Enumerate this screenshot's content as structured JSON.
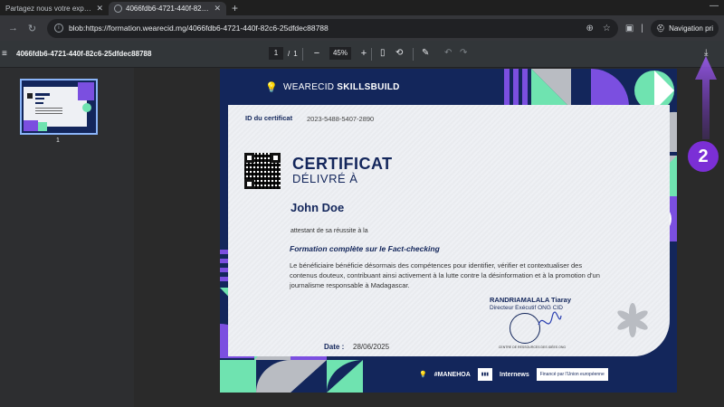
{
  "browser": {
    "tabs": [
      {
        "title": "Partagez nous votre expérience",
        "active": false
      },
      {
        "title": "4066fdb6-4721-440f-82c6-25d",
        "active": true
      }
    ],
    "new_tab_symbol": "+",
    "url": "blob:https://formation.wearecid.mg/4066fdb6-4721-440f-82c6-25dfdec88788",
    "incognito_label": "Navigation pri"
  },
  "pdf_toolbar": {
    "doc_title": "4066fdb6-4721-440f-82c6-25dfdec88788",
    "current_page": "1",
    "page_separator": "/",
    "total_pages": "1",
    "zoom": "45%"
  },
  "sidebar": {
    "thumbnail_label": "1"
  },
  "certificate": {
    "brand_thin": "WEARECID",
    "brand_bold": "SKILLSBUILD",
    "id_label": "ID du certificat",
    "id_value": "2023-5488-5407-2890",
    "title": "CERTIFICAT",
    "subtitle": "DÉLIVRÉ À",
    "recipient": "John Doe",
    "attest_text": "attestant de sa réussite à la",
    "course": "Formation complète sur le Fact-checking",
    "description": "Le bénéficiaire bénéficie désormais des compétences pour identifier, vérifier et contextualiser des contenus douteux, contribuant ainsi activement à la lutte contre la désinformation et à la promotion d'un journalisme responsable à Madagascar.",
    "signer_name": "RANDRIAMALALA Tiaray",
    "signer_role": "Directeur Exécutif ONG CID",
    "seal_caption": "CENTRE DE RESSOURCES DES IDÉES ONG",
    "date_label": "Date :",
    "date_value": "28/06/2025",
    "footer_logos": [
      "#MANEHOA",
      "Internews",
      "Financé par l'Union européenne"
    ]
  },
  "annotation": {
    "step_number": "2"
  },
  "colors": {
    "navy": "#13265b",
    "purple": "#7b4fe0",
    "mint": "#6fe3b0",
    "grey": "#b9bcc2",
    "annotation_purple": "#7b2fd6"
  }
}
